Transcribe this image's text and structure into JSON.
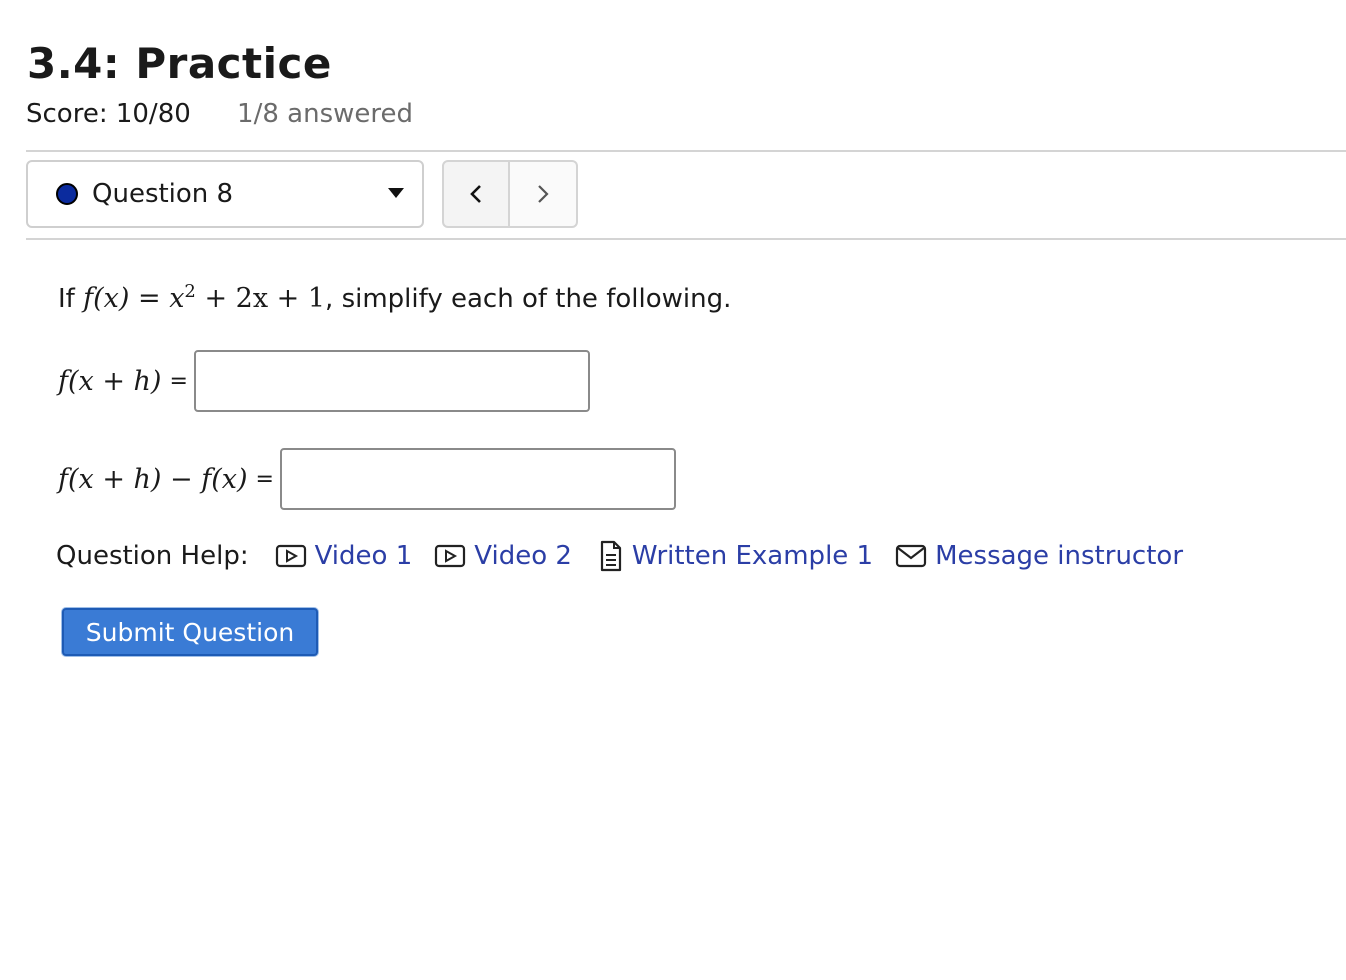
{
  "page": {
    "title": "3.4: Practice",
    "score": "Score: 10/80",
    "answered": "1/8 answered"
  },
  "nav": {
    "question_label": "Question 8",
    "status_color": "#0b2b9e",
    "prev_icon": "chevron-left-icon",
    "next_icon": "chevron-right-icon"
  },
  "question": {
    "prefix": "If",
    "function_lhs": "f(x) =",
    "base": "x",
    "exponent": "2",
    "function_rhs": "+ 2x + 1",
    "suffix": ", simplify each of the following."
  },
  "parts": [
    {
      "expression": "f(x + h)",
      "equals": "=",
      "value": ""
    },
    {
      "expression": "f(x + h) − f(x)",
      "equals": "=",
      "value": ""
    }
  ],
  "help": {
    "label": "Question Help:",
    "links": [
      {
        "label": "Video 1",
        "icon": "video-icon"
      },
      {
        "label": "Video 2",
        "icon": "video-icon"
      },
      {
        "label": "Written Example 1",
        "icon": "document-icon"
      },
      {
        "label": "Message instructor",
        "icon": "envelope-icon"
      }
    ],
    "link_color": "#2b3ea6"
  },
  "submit": {
    "label": "Submit Question",
    "color": "#3a7bd5"
  }
}
